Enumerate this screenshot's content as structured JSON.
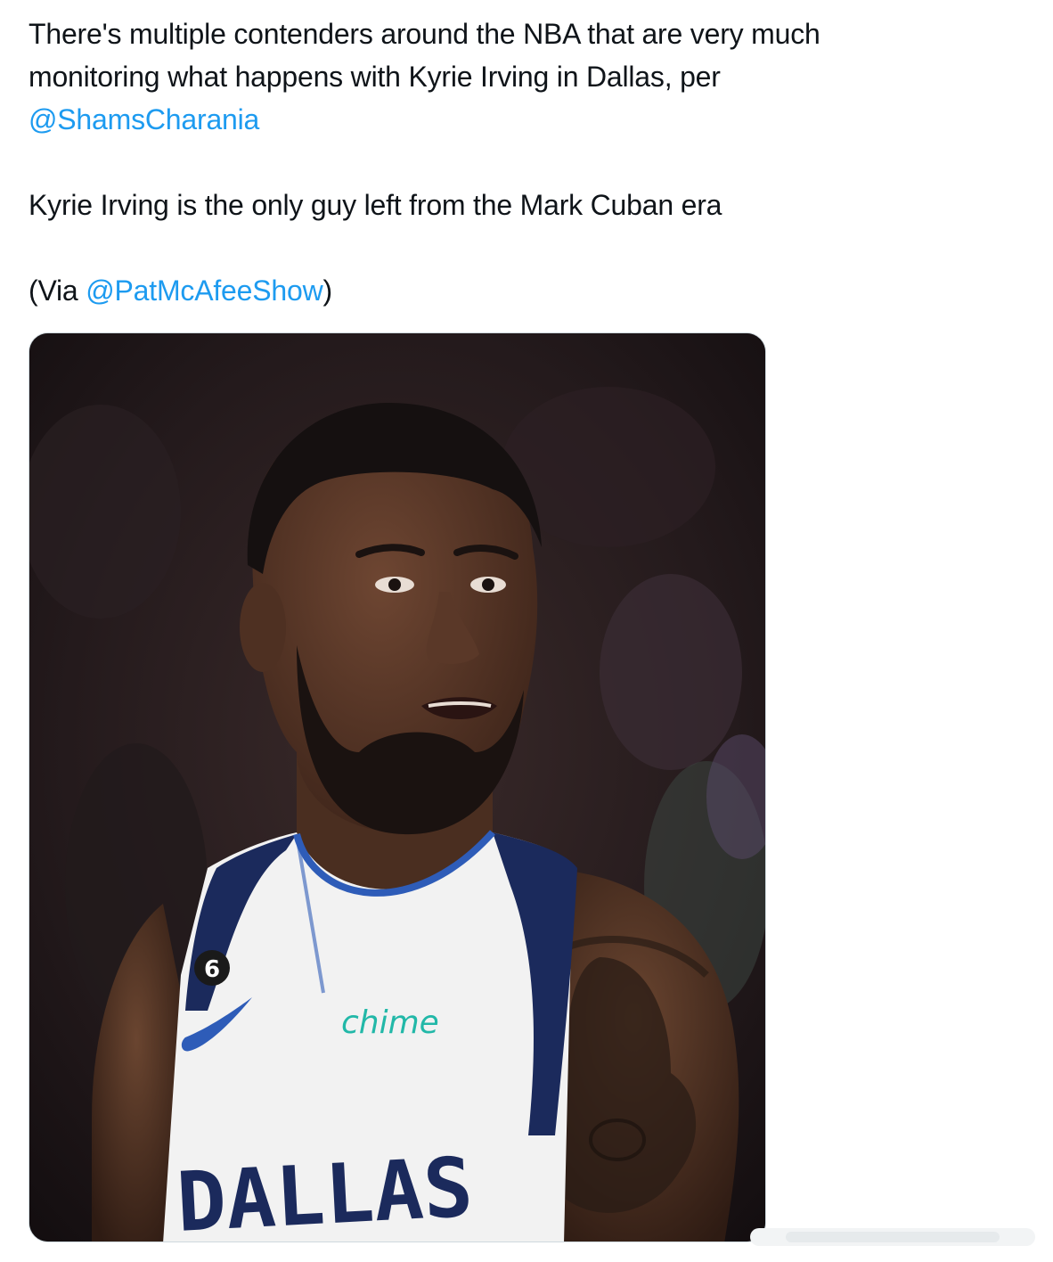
{
  "tweet": {
    "line1": "There's multiple contenders around the NBA that are very much",
    "line2": "monitoring what happens with Kyrie Irving in Dallas, per",
    "mention1": "@ShamsCharania",
    "line3": "Kyrie Irving is the only guy left from the Mark Cuban era",
    "via_prefix": "(Via ",
    "mention2": "@PatMcAfeeShow",
    "via_suffix": ")"
  },
  "media": {
    "alt": "Kyrie Irving in a white Dallas Mavericks jersey",
    "jersey_logo": "6",
    "sponsor": "chime",
    "jersey_text": "DALLAS"
  },
  "colors": {
    "mention": "#1d9bf0",
    "text": "#0f1419",
    "jersey_navy": "#1b2a5c",
    "jersey_blue": "#2e5cb8",
    "sponsor_teal": "#22b8a8"
  }
}
